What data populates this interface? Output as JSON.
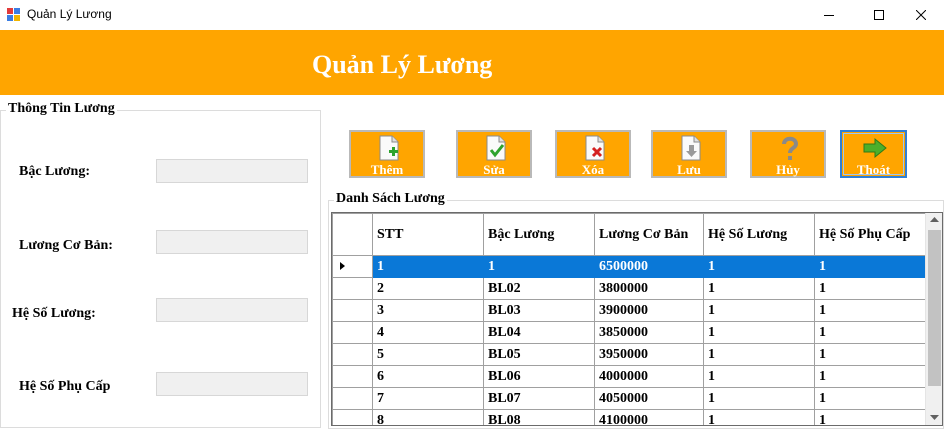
{
  "window": {
    "title": "Quản Lý Lương"
  },
  "header": {
    "title": "Quản Lý Lương",
    "background": "#ffa500"
  },
  "info_group": {
    "legend": "Thông Tin Lương",
    "fields": [
      {
        "label": "Bậc Lương:",
        "value": ""
      },
      {
        "label": "Lương Cơ Bản:",
        "value": ""
      },
      {
        "label": "Hệ Số Lương:",
        "value": ""
      },
      {
        "label": "Hệ Số Phụ Cấp",
        "value": ""
      }
    ]
  },
  "toolbar": {
    "buttons": [
      {
        "label": "Thêm",
        "icon": "add-document-icon"
      },
      {
        "label": "Sửa",
        "icon": "edit-document-icon"
      },
      {
        "label": "Xóa",
        "icon": "delete-document-icon"
      },
      {
        "label": "Lưu",
        "icon": "save-document-icon"
      },
      {
        "label": "Hủy",
        "icon": "question-icon"
      },
      {
        "label": "Thoát",
        "icon": "exit-arrow-icon"
      }
    ]
  },
  "list_group": {
    "legend": "Danh Sách Lương"
  },
  "table": {
    "columns": [
      "STT",
      "Bậc Lương",
      "Lương Cơ Bản",
      "Hệ Số Lương",
      "Hệ Số Phụ Cấp"
    ],
    "selected_row": 0,
    "selection_color": "#0a78d7",
    "rows": [
      [
        "1",
        "1",
        "6500000",
        "1",
        "1"
      ],
      [
        "2",
        "BL02",
        "3800000",
        "1",
        "1"
      ],
      [
        "3",
        "BL03",
        "3900000",
        "1",
        "1"
      ],
      [
        "4",
        "BL04",
        "3850000",
        "1",
        "1"
      ],
      [
        "5",
        "BL05",
        "3950000",
        "1",
        "1"
      ],
      [
        "6",
        "BL06",
        "4000000",
        "1",
        "1"
      ],
      [
        "7",
        "BL07",
        "4050000",
        "1",
        "1"
      ],
      [
        "8",
        "BL08",
        "4100000",
        "1",
        "1"
      ]
    ]
  }
}
